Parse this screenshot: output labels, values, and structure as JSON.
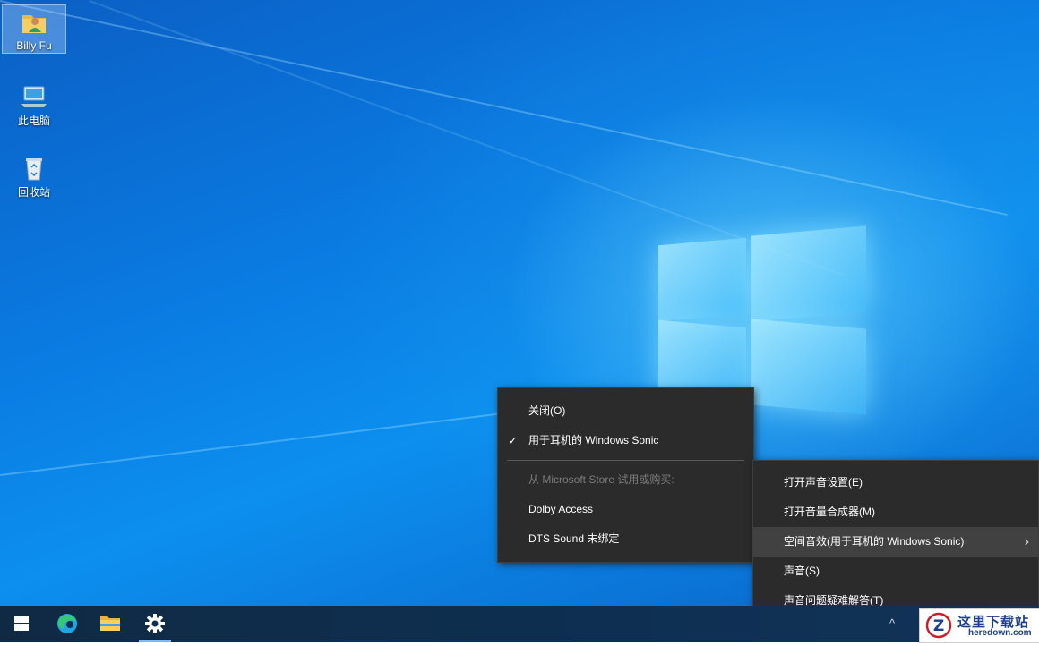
{
  "desktop": {
    "icons": [
      {
        "label": "Billy Fu",
        "icon": "user-folder-icon",
        "selected": true
      },
      {
        "label": "此电脑",
        "icon": "computer-icon",
        "selected": false
      },
      {
        "label": "回收站",
        "icon": "recycle-bin-icon",
        "selected": false
      }
    ]
  },
  "spatial_menu": {
    "items": [
      {
        "label": "关闭(O)",
        "checked": false,
        "disabled": false
      },
      {
        "label": "用于耳机的 Windows Sonic",
        "checked": true,
        "disabled": false
      }
    ],
    "store_header": "从 Microsoft Store 试用或购买:",
    "store_items": [
      {
        "label": "Dolby Access"
      },
      {
        "label": "DTS Sound 未绑定"
      }
    ]
  },
  "sound_menu": {
    "items": [
      {
        "label": "打开声音设置(E)",
        "has_submenu": false,
        "hover": false
      },
      {
        "label": "打开音量合成器(M)",
        "has_submenu": false,
        "hover": false
      },
      {
        "label": "空间音效(用于耳机的 Windows Sonic)",
        "has_submenu": true,
        "hover": true
      },
      {
        "label": "声音(S)",
        "has_submenu": false,
        "hover": false
      },
      {
        "label": "声音问题疑难解答(T)",
        "has_submenu": false,
        "hover": false
      }
    ]
  },
  "taskbar": {
    "buttons": [
      "start-icon",
      "edge-icon",
      "file-explorer-icon",
      "settings-icon"
    ],
    "active": "settings-icon",
    "tray_arrow": "^"
  },
  "watermark": {
    "title": "这里下载站",
    "subtitle": "heredown.com"
  },
  "colors": {
    "menu_bg": "#2b2b2b",
    "menu_hover": "#414141",
    "taskbar_bg": "#102a44"
  }
}
